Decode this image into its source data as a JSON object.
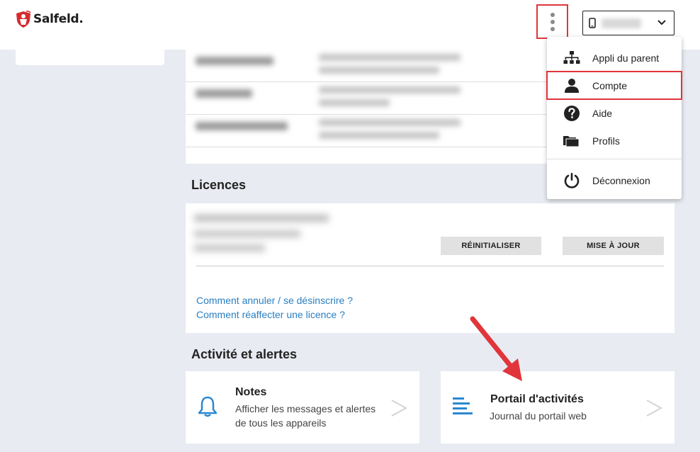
{
  "header": {
    "logo_text": "Salfeld.",
    "device_selected": "",
    "colors": {
      "brand_red": "#d62b30",
      "highlight_red": "#e0353b"
    }
  },
  "dropdown_menu": {
    "items": [
      {
        "label": "Appli du parent",
        "icon": "sitemap-icon"
      },
      {
        "label": "Compte",
        "icon": "user-icon"
      },
      {
        "label": "Aide",
        "icon": "help-icon"
      },
      {
        "label": "Profils",
        "icon": "folder-icon"
      },
      {
        "label": "Déconnexion",
        "icon": "power-icon"
      }
    ]
  },
  "licences": {
    "title": "Licences",
    "reset_label": "RÉINITIALISER",
    "update_label": "MISE À JOUR",
    "link_cancel": "Comment annuler / se désinscrire ?",
    "link_reassign": "Comment réaffecter une licence ?"
  },
  "activity": {
    "title": "Activité et alertes",
    "notes": {
      "title": "Notes",
      "desc_line1": "Afficher les messages et alertes",
      "desc_line2": "de tous les appareils"
    },
    "portal": {
      "title": "Portail d'activités",
      "desc": "Journal du portail web"
    }
  },
  "colors": {
    "link": "#2a7fc1",
    "icon_blue": "#2a88d1",
    "background": "#e9ebf2"
  }
}
